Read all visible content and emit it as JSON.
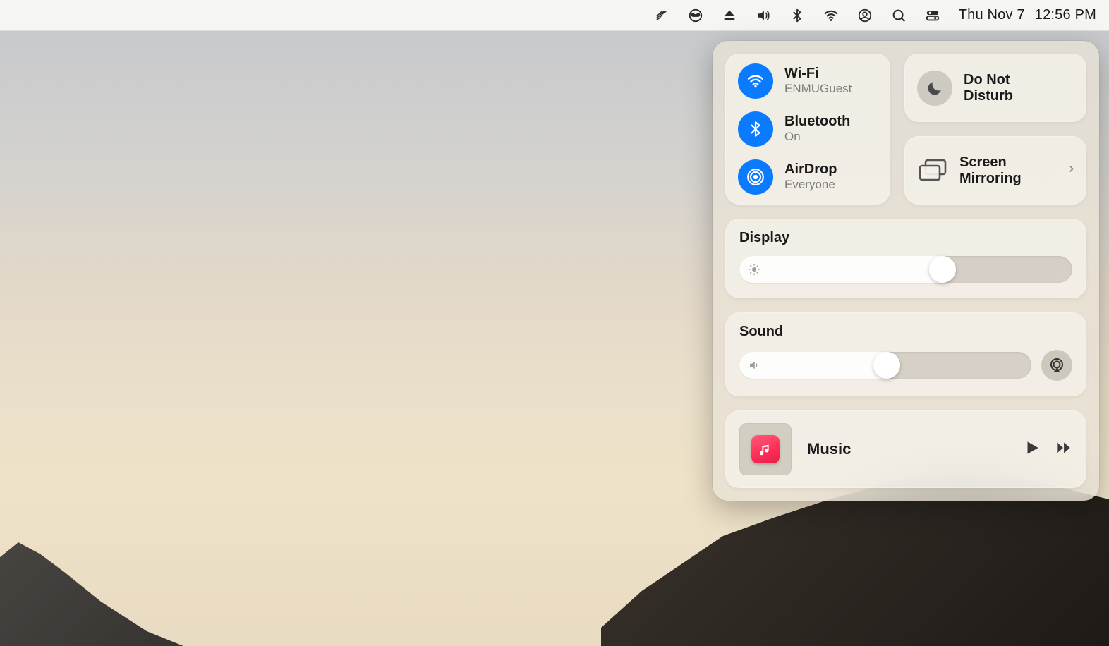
{
  "menubar": {
    "date": "Thu Nov 7",
    "time": "12:56 PM"
  },
  "control_center": {
    "wifi": {
      "label": "Wi-Fi",
      "status": "ENMUGuest"
    },
    "bluetooth": {
      "label": "Bluetooth",
      "status": "On"
    },
    "airdrop": {
      "label": "AirDrop",
      "status": "Everyone"
    },
    "dnd": {
      "label_line1": "Do Not",
      "label_line2": "Disturb"
    },
    "mirror": {
      "label_line1": "Screen",
      "label_line2": "Mirroring"
    },
    "display": {
      "label": "Display",
      "value_pct": 65
    },
    "sound": {
      "label": "Sound",
      "value_pct": 55
    },
    "music": {
      "app_label": "Music"
    }
  }
}
